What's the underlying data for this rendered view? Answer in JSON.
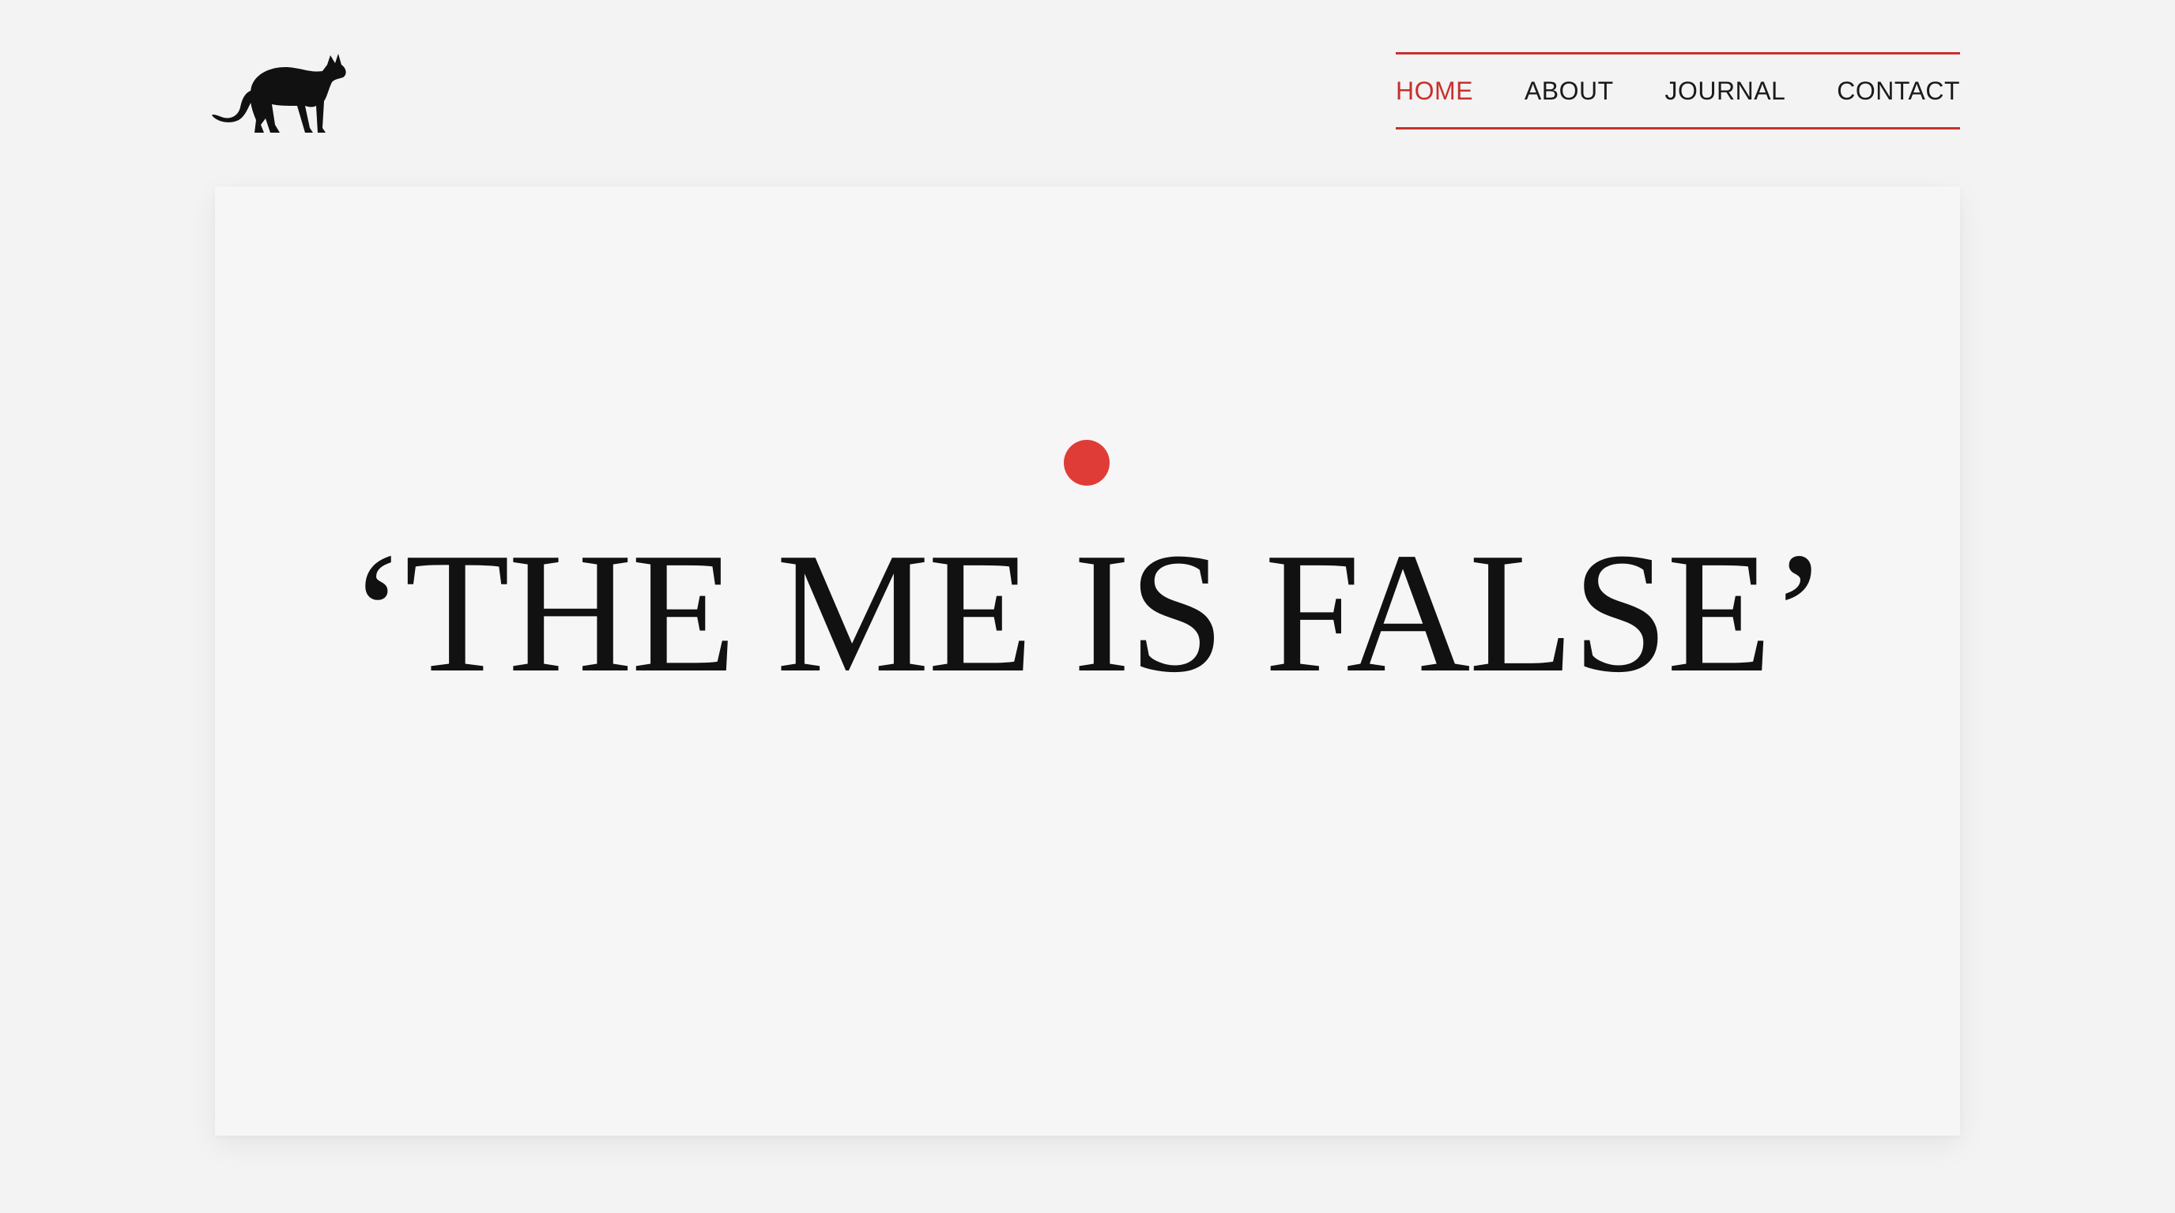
{
  "brand": {
    "logo_icon": "cat-silhouette-icon"
  },
  "nav": {
    "items": [
      {
        "label": "HOME",
        "active": true
      },
      {
        "label": "ABOUT",
        "active": false
      },
      {
        "label": "JOURNAL",
        "active": false
      },
      {
        "label": "CONTACT",
        "active": false
      }
    ]
  },
  "hero": {
    "headline": "‘THE ME IS FALSE’",
    "accent_dot_icon": "red-dot-icon"
  },
  "colors": {
    "accent": "#c8302c",
    "dot": "#e03c37",
    "background": "#f3f3f3",
    "text": "#111111"
  }
}
